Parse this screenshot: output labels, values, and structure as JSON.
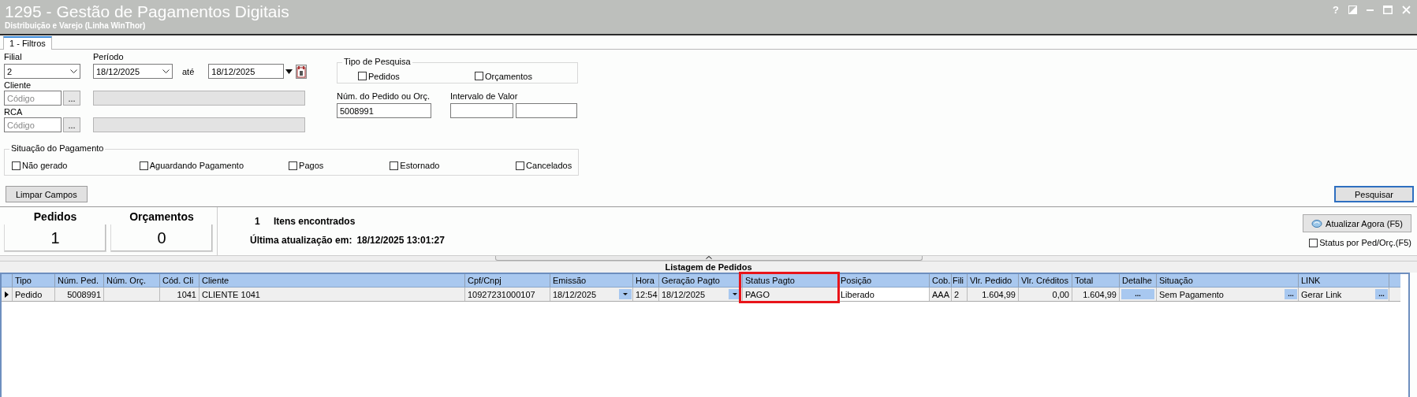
{
  "window": {
    "title": "1295 - Gestão de Pagamentos Digitais",
    "subtitle": "Distribuição e Varejo (Linha WinThor)",
    "help": "?"
  },
  "tabs": [
    {
      "label": "1 - Filtros",
      "selected": true
    }
  ],
  "filters": {
    "filial": {
      "label": "Filial",
      "value": "2"
    },
    "periodo": {
      "label": "Período",
      "from": "18/12/2025",
      "to_label": "até",
      "to": "18/12/2025"
    },
    "tipo_pesquisa": {
      "title": "Tipo de Pesquisa",
      "options": [
        {
          "label": "Pedidos",
          "checked": false
        },
        {
          "label": "Orçamentos",
          "checked": false
        }
      ]
    },
    "cliente": {
      "label": "Cliente",
      "placeholder": "Código",
      "lookup": "..."
    },
    "rca": {
      "label": "RCA",
      "placeholder": "Código",
      "lookup": "..."
    },
    "num_pedido": {
      "label": "Núm. do Pedido ou Orç.",
      "value": "5008991"
    },
    "intervalo_valor": {
      "label": "Intervalo de Valor"
    },
    "situacao": {
      "title": "Situação do Pagamento",
      "options": [
        {
          "label": "Não gerado",
          "checked": false
        },
        {
          "label": "Aguardando Pagamento",
          "checked": false
        },
        {
          "label": "Pagos",
          "checked": false
        },
        {
          "label": "Estornado",
          "checked": false
        },
        {
          "label": "Cancelados",
          "checked": false
        }
      ]
    },
    "clear_button": "Limpar Campos",
    "search_button": "Pesquisar"
  },
  "summary": {
    "cards": [
      {
        "label": "Pedidos",
        "count": "1"
      },
      {
        "label": "Orçamentos",
        "count": "0"
      }
    ],
    "found_count": "1",
    "found_label": "Itens encontrados",
    "updated_label": "Última atualização em:",
    "updated_value": "18/12/2025 13:01:27",
    "refresh_button": "Atualizar Agora (F5)",
    "status_toggle": {
      "label": "Status por Ped/Orç.(F5)",
      "checked": false
    }
  },
  "grid": {
    "title": "Listagem de Pedidos",
    "columns": [
      {
        "label": "Tipo",
        "kind": "text",
        "highlighted": false
      },
      {
        "label": "Núm. Ped.",
        "kind": "number",
        "highlighted": false
      },
      {
        "label": "Núm. Orç.",
        "kind": "number",
        "highlighted": false
      },
      {
        "label": "Cód. Cli",
        "kind": "number",
        "highlighted": false
      },
      {
        "label": "Cliente",
        "kind": "text",
        "highlighted": false
      },
      {
        "label": "Cpf/Cnpj",
        "kind": "text",
        "highlighted": false
      },
      {
        "label": "Emissão",
        "kind": "dropdown",
        "highlighted": false
      },
      {
        "label": "Hora",
        "kind": "text",
        "highlighted": false
      },
      {
        "label": "Geração Pagto",
        "kind": "dropdown",
        "highlighted": false
      },
      {
        "label": "Status Pagto",
        "kind": "text",
        "highlighted": true
      },
      {
        "label": "Posição",
        "kind": "input",
        "highlighted": false
      },
      {
        "label": "Cob.",
        "kind": "text",
        "highlighted": false
      },
      {
        "label": "Fili",
        "kind": "text",
        "highlighted": false
      },
      {
        "label": "Vlr. Pedido",
        "kind": "number",
        "highlighted": false
      },
      {
        "label": "Vlr. Créditos",
        "kind": "number",
        "highlighted": false
      },
      {
        "label": "Total",
        "kind": "number",
        "highlighted": false
      },
      {
        "label": "Detalhe",
        "kind": "button",
        "highlighted": false
      },
      {
        "label": "Situação",
        "kind": "lookup",
        "highlighted": false
      },
      {
        "label": "LINK",
        "kind": "lookup",
        "highlighted": false
      }
    ],
    "rows": [
      {
        "selected": true,
        "cells": [
          {
            "text": "Pedido"
          },
          {
            "text": "5008991"
          },
          {},
          {
            "text": "1041"
          },
          {
            "text": "CLIENTE 1041"
          },
          {
            "text": "10927231000107"
          },
          {
            "text": "18/12/2025"
          },
          {
            "text": "12:54"
          },
          {
            "text": "18/12/2025"
          },
          {
            "text": "PAGO"
          },
          {
            "text": "Liberado"
          },
          {
            "text": "AAA"
          },
          {
            "text": "2"
          },
          {
            "text": "1.604,99"
          },
          {
            "text": "0,00"
          },
          {
            "text": "1.604,99"
          },
          {
            "button": "..."
          },
          {
            "text": "Sem Pagamento",
            "button": "..."
          },
          {
            "text": "Gerar Link",
            "button": "..."
          }
        ]
      }
    ]
  }
}
